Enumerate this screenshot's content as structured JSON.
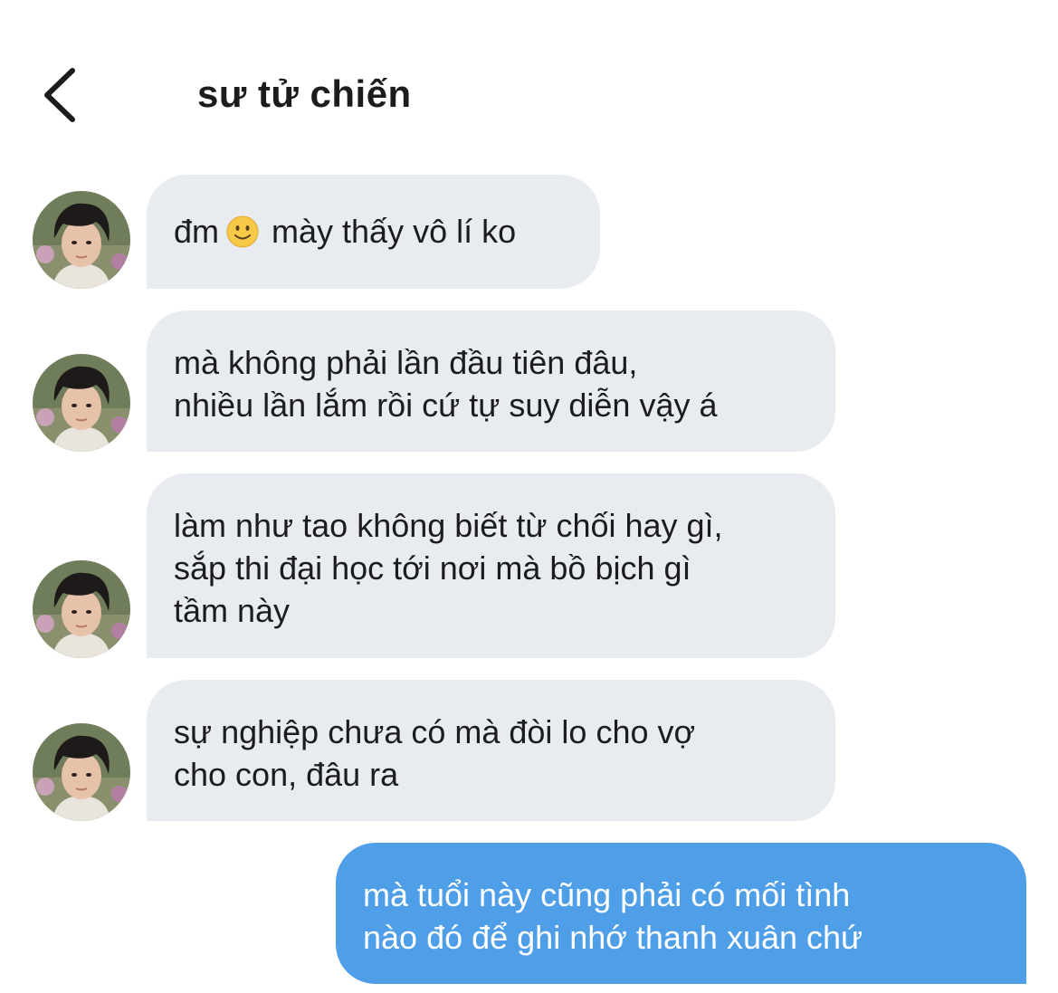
{
  "header": {
    "title": "sư tử chiến",
    "back_icon": "chevron-left-icon"
  },
  "messages": [
    {
      "sender": "other",
      "before_emoji": "đm",
      "emoji": "slightly-smiling-face",
      "after_emoji": "mày thấy vô lí ko"
    },
    {
      "sender": "other",
      "lines": [
        "mà không phải lần đầu tiên đâu,",
        "nhiều lần lắm rồi cứ tự suy diễn vậy á"
      ]
    },
    {
      "sender": "other",
      "lines": [
        "làm như tao không biết từ chối hay gì,",
        "sắp thi đại học tới nơi mà bồ bịch gì",
        "tầm này"
      ]
    },
    {
      "sender": "other",
      "lines": [
        "sự nghiệp chưa có mà đòi lo cho vợ",
        "cho con, đâu ra"
      ]
    },
    {
      "sender": "me",
      "lines": [
        "mà tuổi này cũng phải có mối tình",
        "nào đó để ghi nhớ thanh xuân chứ"
      ]
    }
  ],
  "colors": {
    "received_bubble": "#e8ecf0",
    "sent_bubble": "#4f9ee8",
    "text": "#1c1c1e",
    "sent_text": "#ffffff"
  }
}
